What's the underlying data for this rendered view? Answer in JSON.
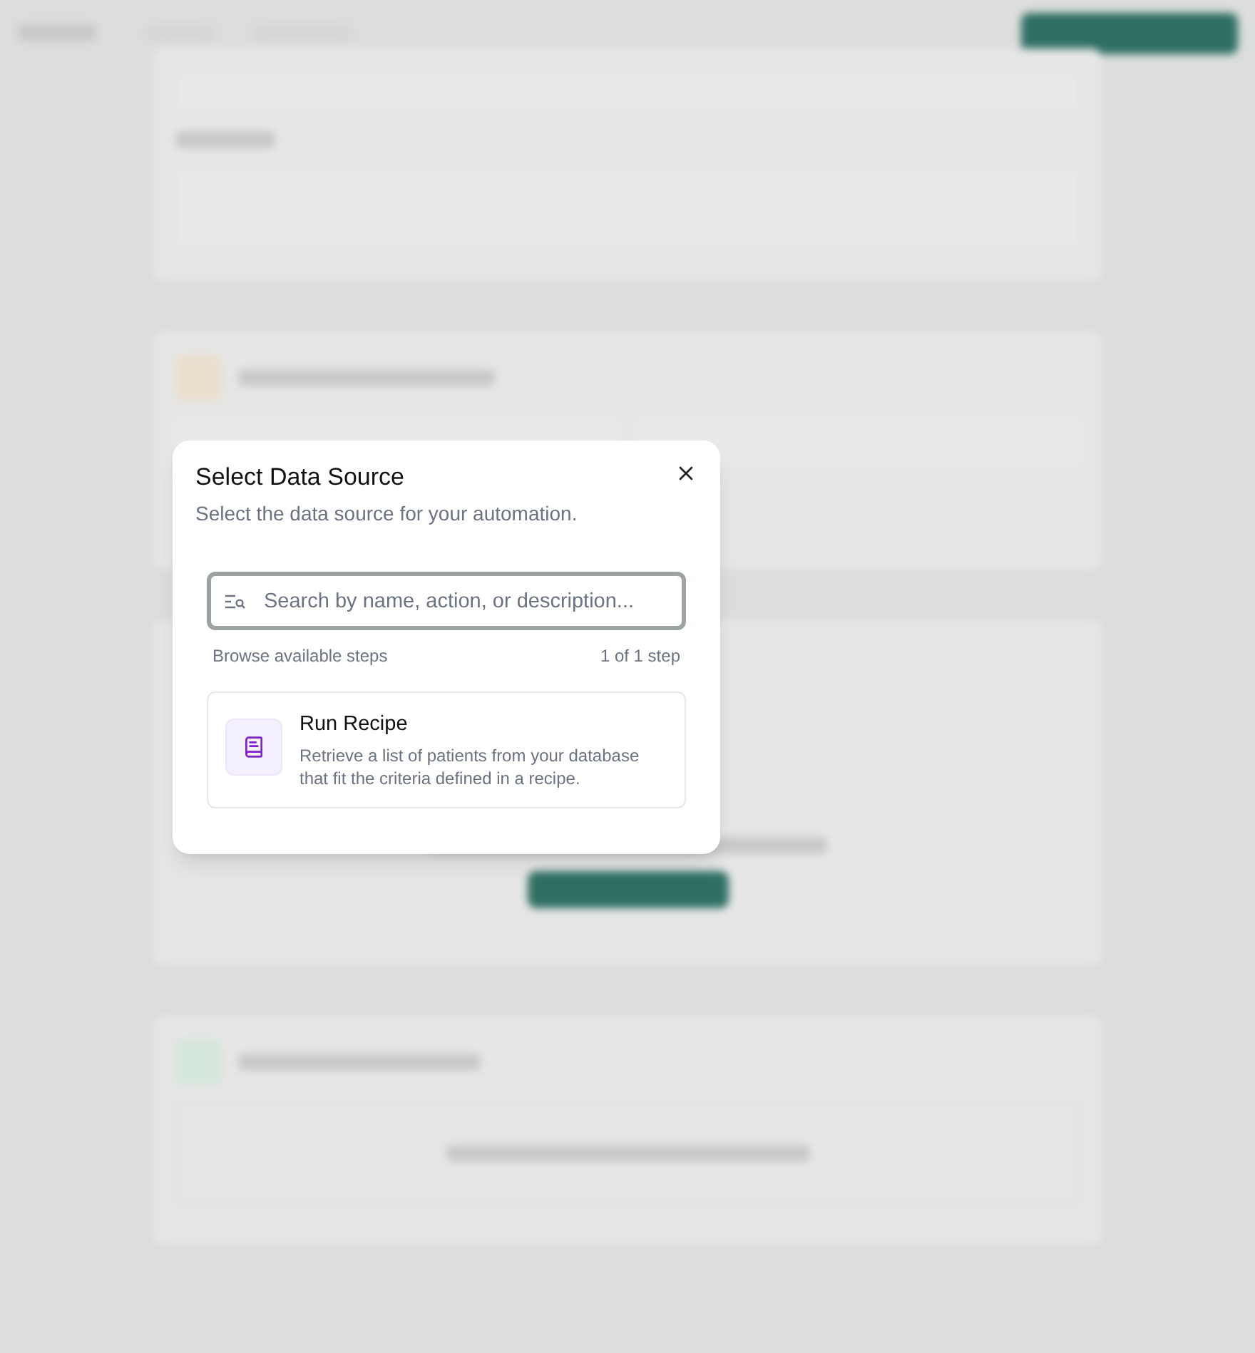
{
  "dialog": {
    "title": "Select Data Source",
    "subtitle": "Select the data source for your automation.",
    "search": {
      "placeholder": "Search by name, action, or description..."
    },
    "list_label": "Browse available steps",
    "count": "1 of 1 step",
    "items": [
      {
        "title": "Run Recipe",
        "description": "Retrieve a list of patients from your database that fit the criteria defined in a recipe."
      }
    ]
  }
}
